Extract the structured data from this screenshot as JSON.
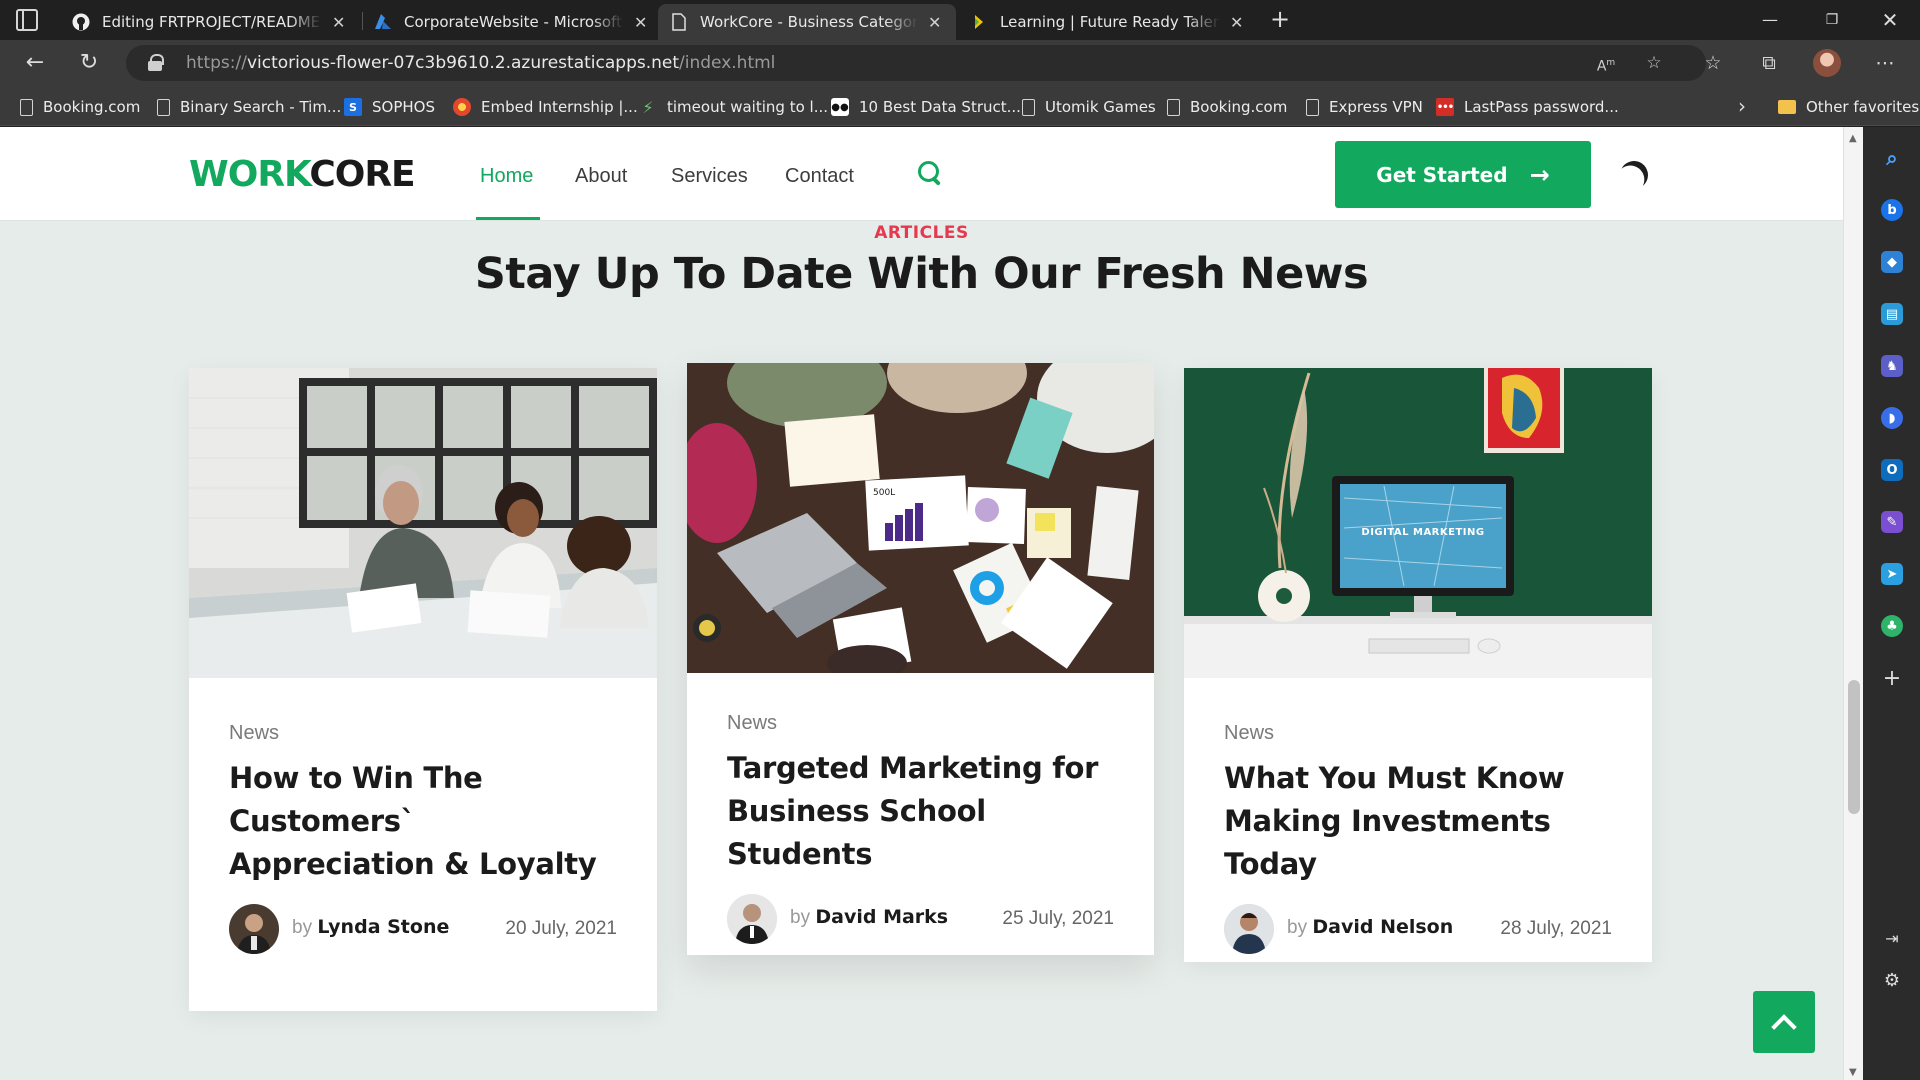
{
  "browser": {
    "tabs": [
      {
        "title": "Editing FRTPROJECT/README.md",
        "icon": "github-icon"
      },
      {
        "title": "CorporateWebsite - Microsoft Azure",
        "icon": "azure-icon"
      },
      {
        "title": "WorkCore - Business Category Blog",
        "icon": "page-icon",
        "active": true
      },
      {
        "title": "Learning | Future Ready Talent",
        "icon": "frt-icon"
      }
    ],
    "url_prefix": "https://",
    "url_host": "victorious-flower-07c3b9610.2.azurestaticapps.net",
    "url_path": "/index.html",
    "favorites": [
      {
        "label": "Booking.com",
        "icon": "page"
      },
      {
        "label": "Binary Search - Tim...",
        "icon": "page"
      },
      {
        "label": "SOPHOS",
        "icon": "sophos"
      },
      {
        "label": "Embed Internship |...",
        "icon": "embed"
      },
      {
        "label": "timeout waiting to l...",
        "icon": "leaf"
      },
      {
        "label": "10 Best Data Struct...",
        "icon": "blk"
      },
      {
        "label": "Utomik Games",
        "icon": "page"
      },
      {
        "label": "Booking.com",
        "icon": "page"
      },
      {
        "label": "Express VPN",
        "icon": "page"
      },
      {
        "label": "LastPass password...",
        "icon": "lp"
      }
    ],
    "other_favorites": "Other favorites"
  },
  "site": {
    "logo_accent": "WORK",
    "logo_main": "CORE",
    "nav": {
      "home": "Home",
      "about": "About",
      "services": "Services",
      "contact": "Contact"
    },
    "cta": "Get Started",
    "colors": {
      "brand": "#12a95e",
      "eyebrow": "#e63950",
      "bg": "#e6ece9"
    }
  },
  "section": {
    "eyebrow": "ARTICLES",
    "title": "Stay Up To Date With Our Fresh News"
  },
  "articles": [
    {
      "category": "News",
      "title": "How to Win The Customers` Appreciation & Loyalty",
      "by": "by",
      "author": "Lynda Stone",
      "date": "20 July, 2021"
    },
    {
      "category": "News",
      "title": "Targeted Marketing for Business School Students",
      "by": "by",
      "author": "David Marks",
      "date": "25 July, 2021"
    },
    {
      "category": "News",
      "title": "What You Must Know Making Investments Today",
      "by": "by",
      "author": "David Nelson",
      "date": "28 July, 2021"
    }
  ],
  "image_text": {
    "monitor": "DIGITAL MARKETING",
    "chart_label": "500L"
  }
}
